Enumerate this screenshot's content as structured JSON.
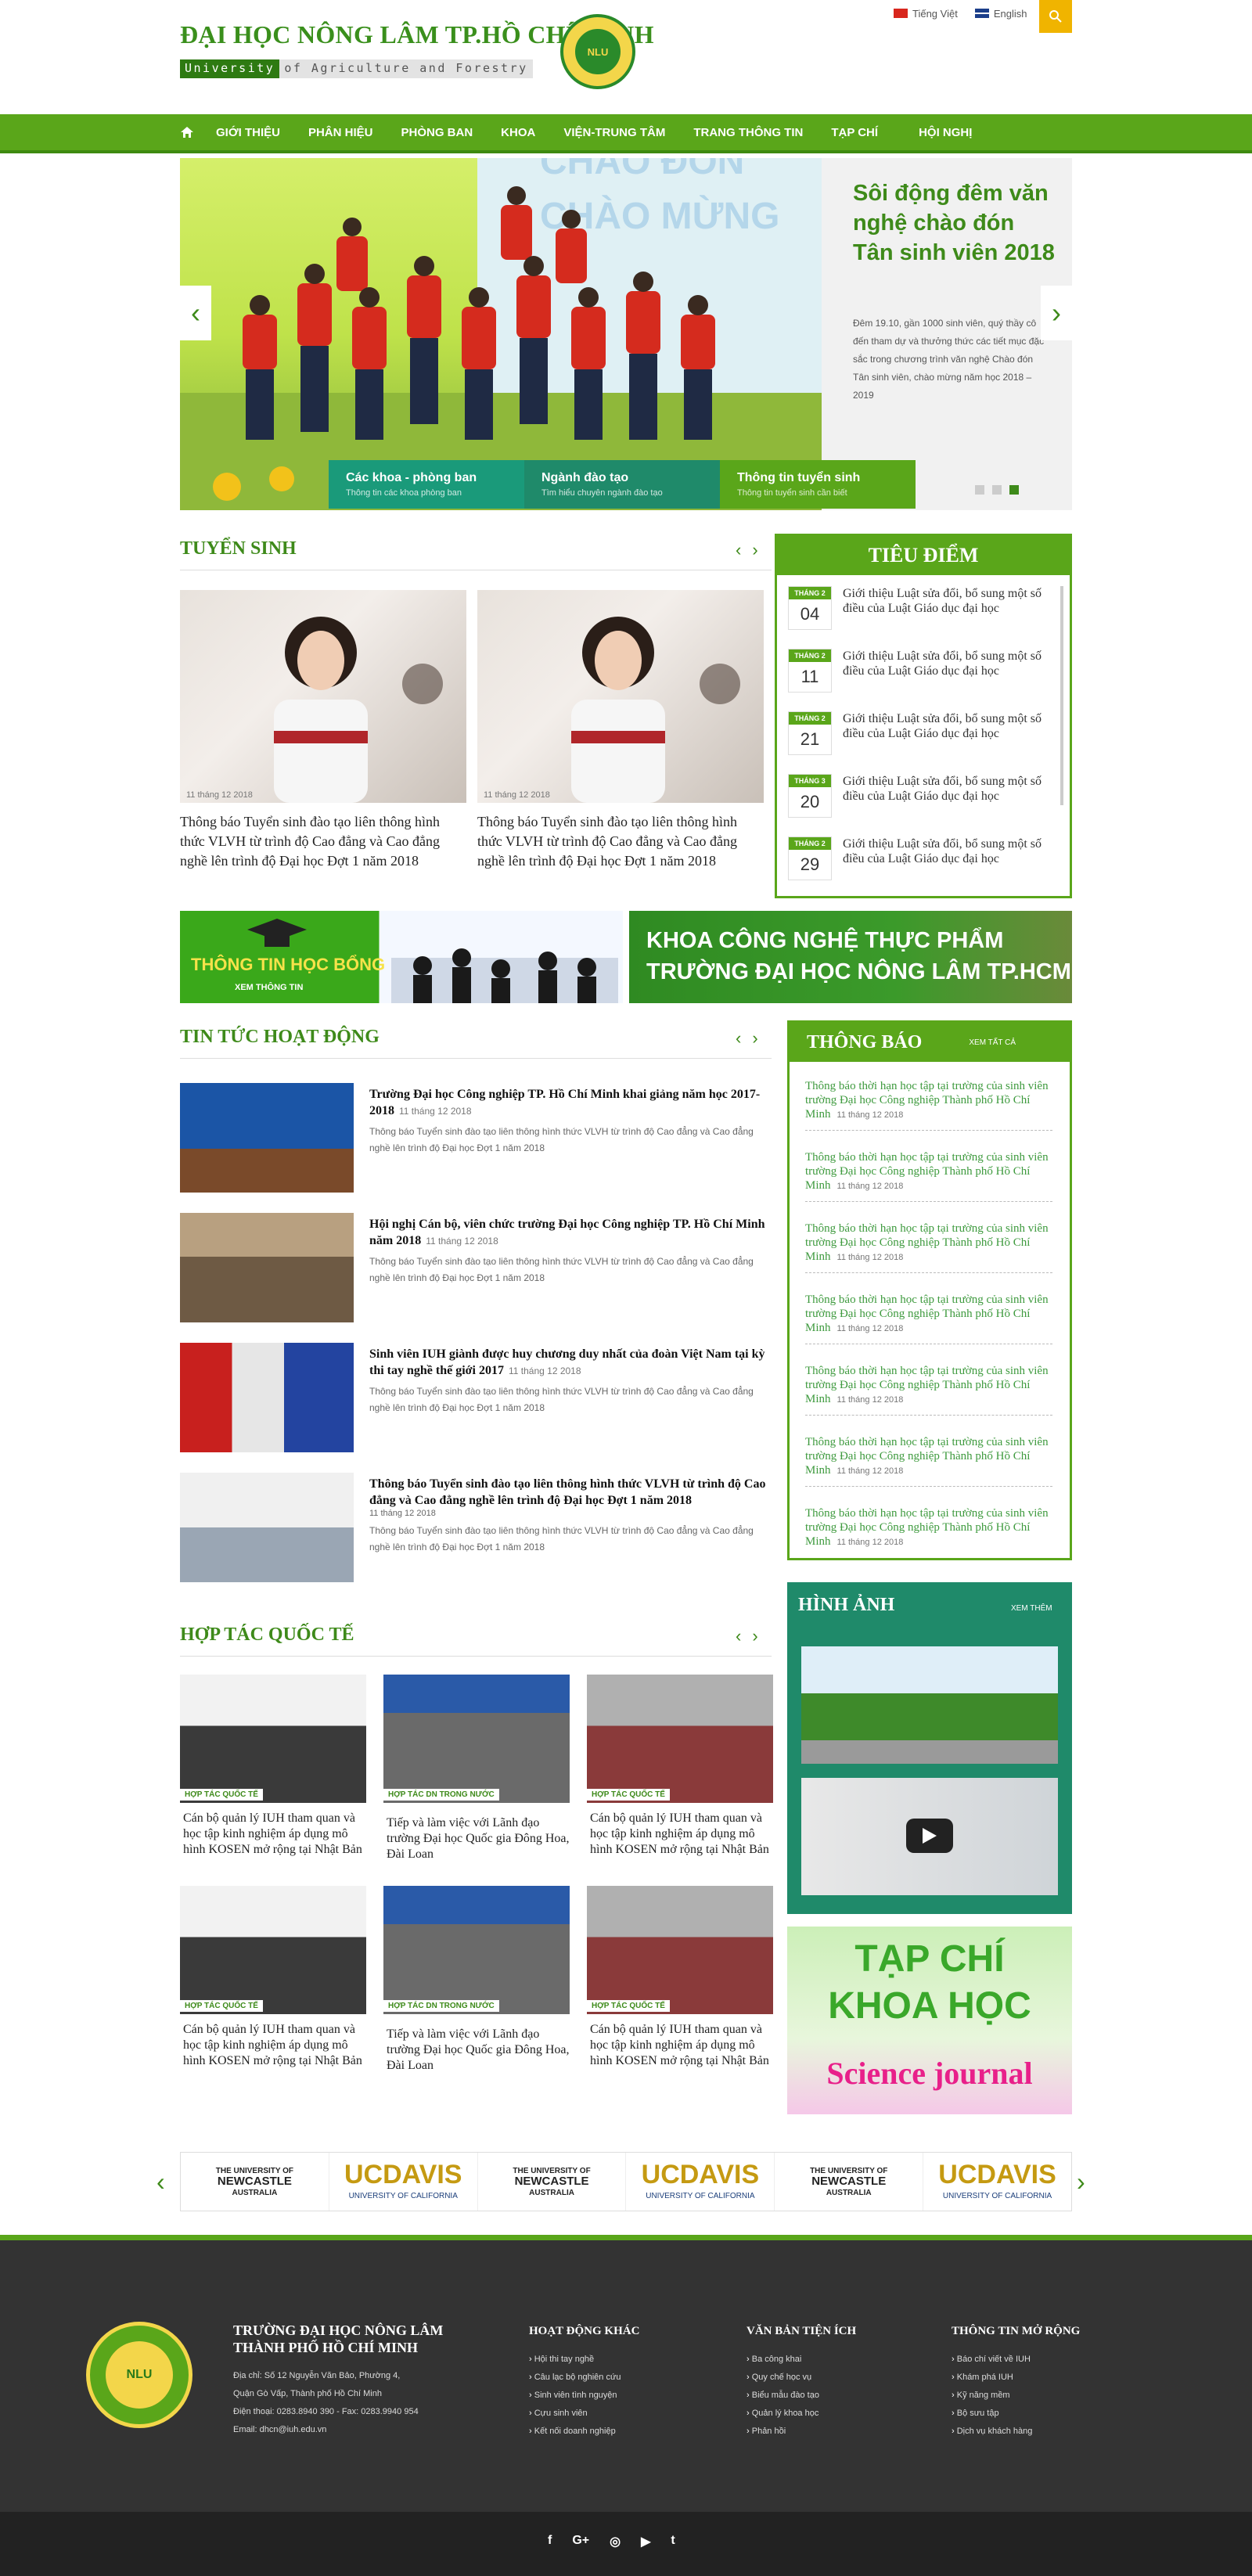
{
  "header": {
    "title": "ĐẠI HỌC NÔNG LÂM TP.HỒ CHÍ MINH",
    "sub_a": "University",
    "sub_b": "of Agriculture and Forestry",
    "seal": "NLU",
    "lang_vi": "Tiếng Việt",
    "lang_en": "English"
  },
  "nav": [
    "GIỚI THIỆU",
    "PHÂN HIỆU",
    "PHÒNG BAN",
    "KHOA",
    "VIỆN-TRUNG TÂM",
    "TRANG THÔNG TIN",
    "TẠP CHÍ",
    "HỘI NGHỊ"
  ],
  "slider": {
    "title": "Sôi động đêm văn nghệ chào đón Tân sinh viên 2018",
    "desc": "Đêm 19.10, gần 1000 sinh viên, quý thầy cô đến tham dự và thưởng thức các tiết mục đặc sắc trong chương trình văn nghệ Chào đón Tân sinh viên, chào mừng năm học 2018 – 2019",
    "bg_text": "CHÀO ĐÓN CHÀO MỪNG",
    "tabs": [
      {
        "t": "Các khoa - phòng ban",
        "s": "Thông tin các khoa phòng ban",
        "c": "#1a9a7a"
      },
      {
        "t": "Ngành đào tạo",
        "s": "Tìm hiểu chuyên ngành đào tạo",
        "c": "#1f8a6a"
      },
      {
        "t": "Thông tin tuyển sinh",
        "s": "Thông tin tuyển sinh cần biết",
        "c": "#5aa61a"
      }
    ]
  },
  "tuyensinh": {
    "title": "TUYỂN SINH",
    "cards": [
      {
        "date": "11 tháng 12 2018",
        "title": "Thông báo Tuyển sinh đào tạo liên thông hình thức VLVH từ trình độ Cao đẳng và Cao đẳng nghề lên trình độ Đại học Đợt 1 năm 2018"
      },
      {
        "date": "11 tháng 12 2018",
        "title": "Thông báo Tuyển sinh đào tạo liên thông hình thức VLVH từ trình độ Cao đẳng và Cao đẳng nghề lên trình độ Đại học Đợt 1 năm 2018"
      }
    ]
  },
  "tieudiem": {
    "title": "TIÊU ĐIỂM",
    "items": [
      {
        "m": "THÁNG 2",
        "d": "04",
        "t": "Giới thiệu Luật sửa đổi, bổ sung một số điều của Luật Giáo dục đại học"
      },
      {
        "m": "THÁNG 2",
        "d": "11",
        "t": "Giới thiệu Luật sửa đổi, bổ sung một số điều của Luật Giáo dục đại học"
      },
      {
        "m": "THÁNG 2",
        "d": "21",
        "t": "Giới thiệu Luật sửa đổi, bổ sung một số điều của Luật Giáo dục đại học"
      },
      {
        "m": "THÁNG 3",
        "d": "20",
        "t": "Giới thiệu Luật sửa đổi, bổ sung một số điều của Luật Giáo dục đại học"
      },
      {
        "m": "THÁNG 2",
        "d": "29",
        "t": "Giới thiệu Luật sửa đổi, bổ sung một số điều của Luật Giáo dục đại học"
      }
    ]
  },
  "banners": {
    "hocbong": "THÔNG TIN HỌC BỔNG",
    "hocbong_sub": "XEM THÔNG TIN",
    "khoa1": "KHOA CÔNG NGHỆ THỰC PHẨM",
    "khoa2": "TRƯỜNG ĐẠI HỌC NÔNG LÂM TP.HCM"
  },
  "tintuc": {
    "title": "TIN TỨC HOẠT ĐỘNG",
    "items": [
      {
        "t": "Trường Đại học Công nghiệp TP. Hồ Chí Minh khai giảng năm học 2017-2018",
        "date": "11 tháng 12 2018",
        "d": "Thông báo Tuyển sinh đào tạo liên thông hình thức VLVH từ trình độ Cao đẳng và Cao đẳng nghề lên trình độ Đại học Đợt 1 năm 2018"
      },
      {
        "t": "Hội nghị Cán bộ, viên chức trường Đại học Công nghiệp TP. Hồ Chí Minh năm 2018",
        "date": "11 tháng 12 2018",
        "d": "Thông báo Tuyển sinh đào tạo liên thông hình thức VLVH từ trình độ Cao đẳng và Cao đẳng nghề lên trình độ Đại học Đợt 1 năm 2018"
      },
      {
        "t": "Sinh viên IUH giành được huy chương duy nhất của đoàn Việt Nam tại kỳ thi tay nghề thế giới 2017",
        "date": "11 tháng 12 2018",
        "d": "Thông báo Tuyển sinh đào tạo liên thông hình thức VLVH từ trình độ Cao đẳng và Cao đẳng nghề lên trình độ Đại học Đợt 1 năm 2018"
      },
      {
        "t": "Thông báo Tuyển sinh đào tạo liên thông hình thức VLVH từ trình độ Cao đẳng và Cao đẳng nghề lên trình độ Đại học Đợt 1 năm 2018",
        "date": "11 tháng 12 2018",
        "d": "Thông báo Tuyển sinh đào tạo liên thông hình thức VLVH từ trình độ Cao đẳng và Cao đẳng nghề lên trình độ Đại học Đợt 1 năm 2018"
      }
    ]
  },
  "thongbao": {
    "title": "THÔNG BÁO",
    "more": "XEM TẤT CẢ",
    "items": [
      {
        "t": "Thông báo thời hạn học tập tại trường của sinh viên trường Đại học Công nghiệp Thành phố Hồ Chí Minh",
        "date": "11 tháng 12 2018"
      },
      {
        "t": "Thông báo thời hạn học tập tại trường của sinh viên trường Đại học Công nghiệp Thành phố Hồ Chí Minh",
        "date": "11 tháng 12 2018"
      },
      {
        "t": "Thông báo thời hạn học tập tại trường của sinh viên trường Đại học Công nghiệp Thành phố Hồ Chí Minh",
        "date": "11 tháng 12 2018"
      },
      {
        "t": "Thông báo thời hạn học tập tại trường của sinh viên trường Đại học Công nghiệp Thành phố Hồ Chí Minh",
        "date": "11 tháng 12 2018"
      },
      {
        "t": "Thông báo thời hạn học tập tại trường của sinh viên trường Đại học Công nghiệp Thành phố Hồ Chí Minh",
        "date": "11 tháng 12 2018"
      },
      {
        "t": "Thông báo thời hạn học tập tại trường của sinh viên trường Đại học Công nghiệp Thành phố Hồ Chí Minh",
        "date": "11 tháng 12 2018"
      },
      {
        "t": "Thông báo thời hạn học tập tại trường của sinh viên trường Đại học Công nghiệp Thành phố Hồ Chí Minh",
        "date": "11 tháng 12 2018"
      }
    ]
  },
  "hoptac": {
    "title": "HỢP TÁC QUỐC TẾ",
    "items": [
      {
        "tag": "HỢP TÁC QUỐC TẾ",
        "t": "Cán bộ quản lý IUH tham quan và học tập kinh nghiệm áp dụng mô hình KOSEN mở rộng tại Nhật Bản"
      },
      {
        "tag": "HỢP TÁC DN TRONG NƯỚC",
        "t": "Tiếp và làm việc với Lãnh đạo trường Đại học Quốc gia Đông Hoa, Đài Loan"
      },
      {
        "tag": "HỢP TÁC QUỐC TẾ",
        "t": "Cán bộ quản lý IUH tham quan và học tập kinh nghiệm áp dụng mô hình KOSEN mở rộng tại Nhật Bản"
      },
      {
        "tag": "HỢP TÁC QUỐC TẾ",
        "t": "Cán bộ quản lý IUH tham quan và học tập kinh nghiệm áp dụng mô hình KOSEN mở rộng tại Nhật Bản"
      },
      {
        "tag": "HỢP TÁC DN TRONG NƯỚC",
        "t": "Tiếp và làm việc với Lãnh đạo trường Đại học Quốc gia Đông Hoa, Đài Loan"
      },
      {
        "tag": "HỢP TÁC QUỐC TẾ",
        "t": "Cán bộ quản lý IUH tham quan và học tập kinh nghiệm áp dụng mô hình KOSEN mở rộng tại Nhật Bản"
      }
    ]
  },
  "hinhanh": {
    "title": "HÌNH ẢNH",
    "more": "XEM THÊM"
  },
  "tapchi": {
    "l1": "TẠP CHÍ",
    "l2": "KHOA HỌC",
    "l3": "Science journal"
  },
  "partners": [
    {
      "a": "THE UNIVERSITY OF",
      "b": "NEWCASTLE",
      "c": "AUSTRALIA"
    },
    {
      "a": "UCDAVIS",
      "b": "UNIVERSITY OF CALIFORNIA"
    },
    {
      "a": "THE UNIVERSITY OF",
      "b": "NEWCASTLE",
      "c": "AUSTRALIA"
    },
    {
      "a": "UCDAVIS",
      "b": "UNIVERSITY OF CALIFORNIA"
    },
    {
      "a": "THE UNIVERSITY OF",
      "b": "NEWCASTLE",
      "c": "AUSTRALIA"
    },
    {
      "a": "UCDAVIS",
      "b": "UNIVERSITY OF CALIFORNIA"
    }
  ],
  "footer": {
    "name": "TRƯỜNG ĐẠI HỌC NÔNG LÂM THÀNH PHỐ HỒ CHÍ MINH",
    "logo": "NLU",
    "addr": [
      "Địa chỉ: Số 12 Nguyễn Văn Bảo, Phường 4,",
      "Quận Gò Vấp, Thành phố Hồ Chí Minh",
      "Điện thoại: 0283.8940 390 - Fax: 0283.9940 954",
      "Email: dhcn@iuh.edu.vn"
    ],
    "cols": [
      {
        "h": "HOẠT ĐỘNG KHÁC",
        "i": [
          "Hội thi tay nghề",
          "Câu lạc bộ nghiên cứu",
          "Sinh viên tình nguyện",
          "Cựu sinh viên",
          "Kết nối doanh nghiệp"
        ]
      },
      {
        "h": "VĂN BẢN TIỆN ÍCH",
        "i": [
          "Ba công khai",
          "Quy chế học vụ",
          "Biểu mẫu đào tạo",
          "Quản lý khoa học",
          "Phản hồi"
        ]
      },
      {
        "h": "THÔNG TIN MỞ RỘNG",
        "i": [
          "Báo chí viết về IUH",
          "Khám phá IUH",
          "Kỹ năng mềm",
          "Bộ sưu tập",
          "Dịch vụ khách hàng"
        ]
      }
    ]
  },
  "social": [
    "f",
    "G+",
    "◎",
    "▶",
    "t"
  ],
  "colors": {
    "green": "#5aa61a",
    "dark_green": "#1f8a6a",
    "yellow": "#f0b400"
  }
}
